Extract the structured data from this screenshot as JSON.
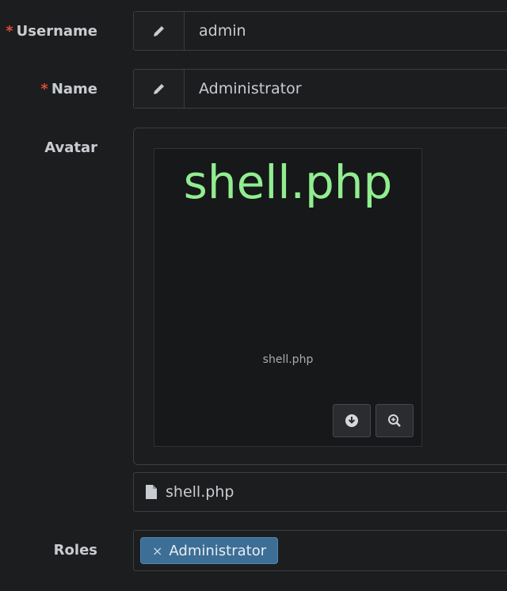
{
  "username": {
    "required_mark": "*",
    "label": "Username",
    "value": "admin",
    "icon": "pencil-icon"
  },
  "name": {
    "required_mark": "*",
    "label": "Name",
    "value": "Administrator",
    "icon": "pencil-icon"
  },
  "avatar": {
    "label": "Avatar",
    "preview_text": "shell.php",
    "caption": "shell.php",
    "preview_text_color": "#90ee90",
    "buttons": [
      "download-icon",
      "zoom-in-icon"
    ],
    "file_name": "shell.php",
    "file_icon": "file-icon"
  },
  "roles": {
    "label": "Roles",
    "tags": [
      {
        "remove": "×",
        "text": "Administrator"
      }
    ],
    "tag_color": "#3c6e96"
  }
}
